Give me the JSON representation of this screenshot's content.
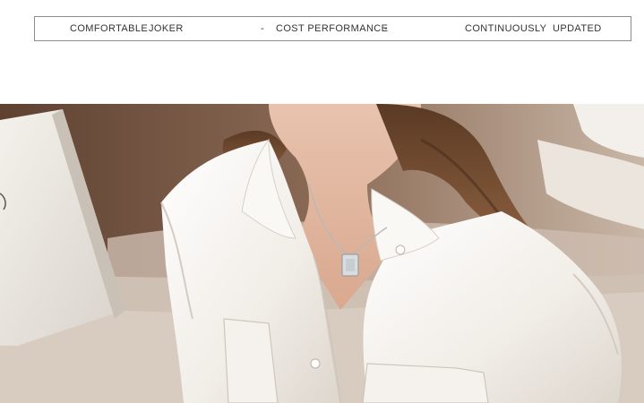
{
  "banner": {
    "words": {
      "w1": "COMFORTABLE",
      "w2": "JOKER",
      "sep1": "-",
      "w3": "COST PERFORMANCE",
      "sep2": "-",
      "w4": "CONTINUOUSLY",
      "w5": "UPDATED"
    }
  },
  "photo": {
    "subject": "model-shirt-necklace"
  },
  "colors": {
    "border": "#8c8c8c",
    "text": "#333333",
    "shirt": "#f6f3ee",
    "background": "#ffffff"
  }
}
